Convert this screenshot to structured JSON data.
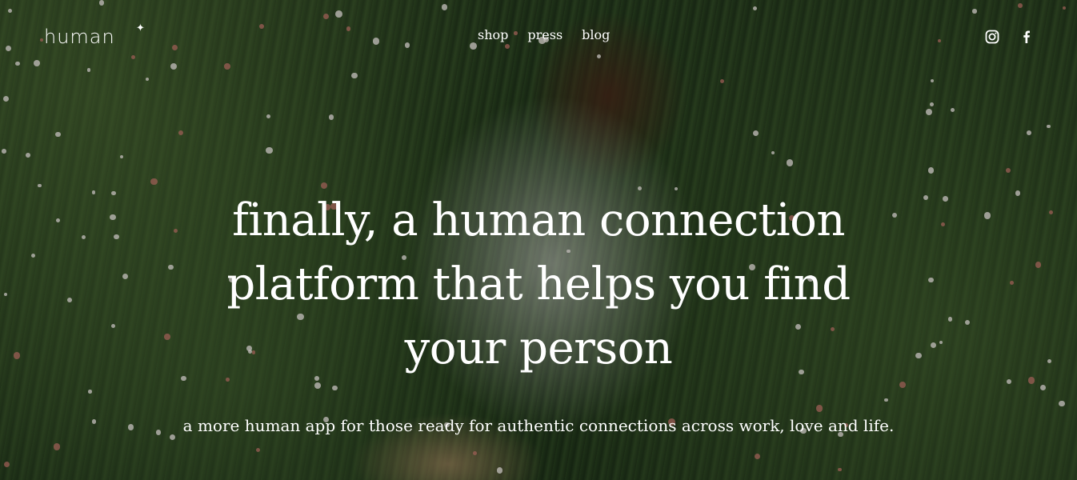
{
  "header": {
    "logo_text": "human",
    "logo_star": "✦",
    "nav": [
      {
        "label": "shop"
      },
      {
        "label": "press"
      },
      {
        "label": "blog"
      }
    ],
    "social_icons": [
      "instagram-icon",
      "facebook-icon"
    ]
  },
  "hero": {
    "headline": "finally, a human connection platform that helps you find your person",
    "subheadline": "a more human app for those ready for authentic connections across work, love and life.",
    "background_image": "woman-lying-in-meadow-photo"
  },
  "colors": {
    "text": "#ffffff",
    "overlay": "#000000"
  }
}
